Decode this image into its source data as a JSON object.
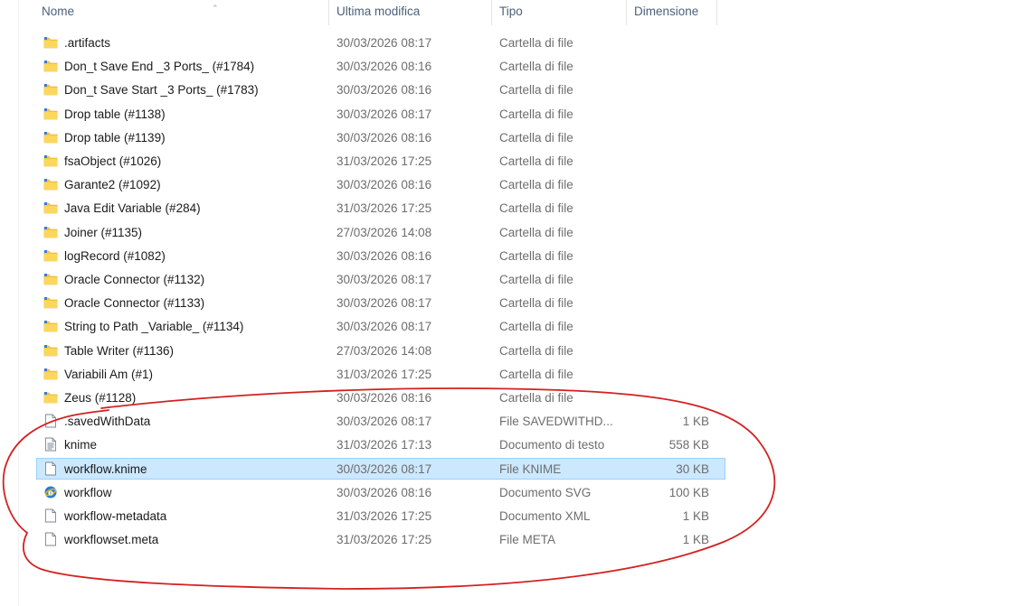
{
  "header": {
    "name": "Nome",
    "modified": "Ultima modifica",
    "type": "Tipo",
    "size": "Dimensione"
  },
  "files": [
    {
      "name": ".artifacts",
      "modified": "30/03/2026 08:17",
      "type": "Cartella di file",
      "size": "",
      "icon": "folder-icon"
    },
    {
      "name": "Don_t Save End _3 Ports_ (#1784)",
      "modified": "30/03/2026 08:16",
      "type": "Cartella di file",
      "size": "",
      "icon": "folder-icon"
    },
    {
      "name": "Don_t Save Start _3 Ports_ (#1783)",
      "modified": "30/03/2026 08:16",
      "type": "Cartella di file",
      "size": "",
      "icon": "folder-icon"
    },
    {
      "name": "Drop table (#1138)",
      "modified": "30/03/2026 08:17",
      "type": "Cartella di file",
      "size": "",
      "icon": "folder-icon"
    },
    {
      "name": "Drop table (#1139)",
      "modified": "30/03/2026 08:16",
      "type": "Cartella di file",
      "size": "",
      "icon": "folder-icon"
    },
    {
      "name": "fsaObject (#1026)",
      "modified": "31/03/2026 17:25",
      "type": "Cartella di file",
      "size": "",
      "icon": "folder-icon"
    },
    {
      "name": "Garante2 (#1092)",
      "modified": "30/03/2026 08:16",
      "type": "Cartella di file",
      "size": "",
      "icon": "folder-icon"
    },
    {
      "name": "Java Edit Variable (#284)",
      "modified": "31/03/2026 17:25",
      "type": "Cartella di file",
      "size": "",
      "icon": "folder-icon"
    },
    {
      "name": "Joiner (#1135)",
      "modified": "27/03/2026 14:08",
      "type": "Cartella di file",
      "size": "",
      "icon": "folder-icon"
    },
    {
      "name": "logRecord (#1082)",
      "modified": "30/03/2026 08:16",
      "type": "Cartella di file",
      "size": "",
      "icon": "folder-icon"
    },
    {
      "name": "Oracle Connector (#1132)",
      "modified": "30/03/2026 08:17",
      "type": "Cartella di file",
      "size": "",
      "icon": "folder-icon"
    },
    {
      "name": "Oracle Connector (#1133)",
      "modified": "30/03/2026 08:17",
      "type": "Cartella di file",
      "size": "",
      "icon": "folder-icon"
    },
    {
      "name": "String to Path _Variable_ (#1134)",
      "modified": "30/03/2026 08:17",
      "type": "Cartella di file",
      "size": "",
      "icon": "folder-icon"
    },
    {
      "name": "Table Writer (#1136)",
      "modified": "27/03/2026 14:08",
      "type": "Cartella di file",
      "size": "",
      "icon": "folder-icon"
    },
    {
      "name": "Variabili Am (#1)",
      "modified": "31/03/2026 17:25",
      "type": "Cartella di file",
      "size": "",
      "icon": "folder-icon"
    },
    {
      "name": "Zeus (#1128)",
      "modified": "30/03/2026 08:16",
      "type": "Cartella di file",
      "size": "",
      "icon": "folder-icon"
    },
    {
      "name": ".savedWithData",
      "modified": "30/03/2026 08:17",
      "type": "File SAVEDWITHD...",
      "size": "1 KB",
      "icon": "file-icon"
    },
    {
      "name": "knime",
      "modified": "31/03/2026 17:13",
      "type": "Documento di testo",
      "size": "558 KB",
      "icon": "text-file-icon"
    },
    {
      "name": "workflow.knime",
      "modified": "30/03/2026 08:17",
      "type": "File KNIME",
      "size": "30 KB",
      "icon": "file-icon",
      "selected": true
    },
    {
      "name": "workflow",
      "modified": "30/03/2026 08:16",
      "type": "Documento SVG",
      "size": "100 KB",
      "icon": "svg-file-icon"
    },
    {
      "name": "workflow-metadata",
      "modified": "31/03/2026 17:25",
      "type": "Documento XML",
      "size": "1 KB",
      "icon": "file-icon"
    },
    {
      "name": "workflowset.meta",
      "modified": "31/03/2026 17:25",
      "type": "File META",
      "size": "1 KB",
      "icon": "file-icon"
    }
  ],
  "colors": {
    "header_text": "#4c607a",
    "selection_bg": "#cce8ff",
    "selection_border": "#99d1ff",
    "folder": "#f8c940",
    "annotation": "#d42020"
  }
}
